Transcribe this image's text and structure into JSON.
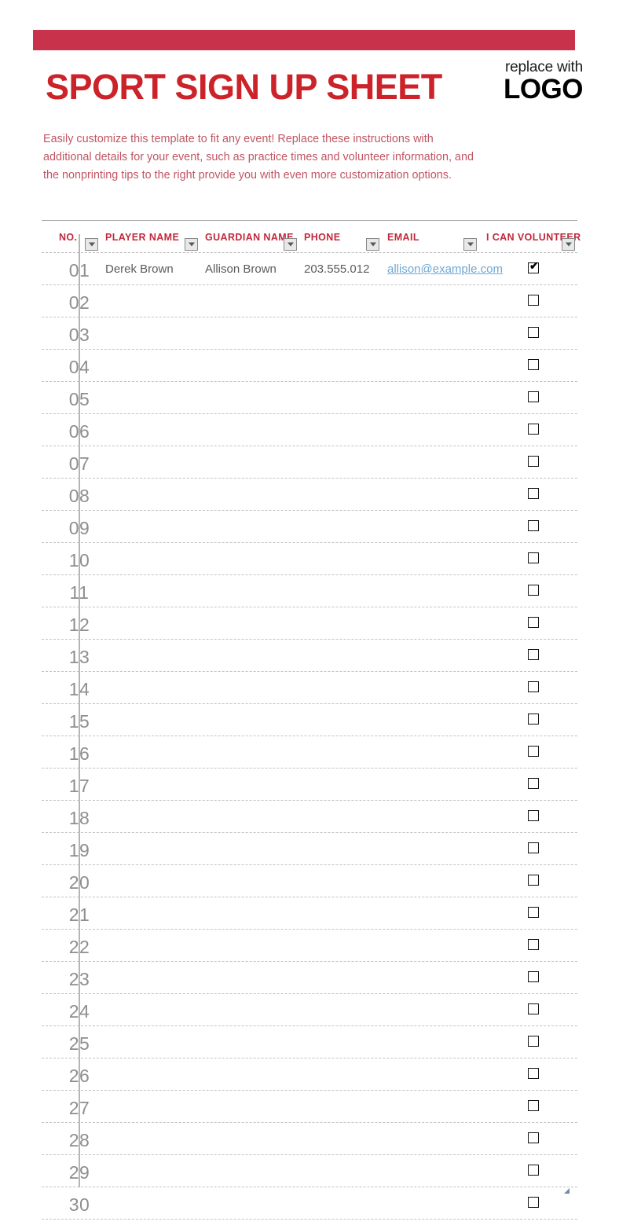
{
  "header": {
    "banner_color": "#c8324a",
    "title": "SPORT SIGN UP SHEET",
    "title_color": "#cc2229",
    "logo_sub": "replace with",
    "logo_main": "LOGO"
  },
  "instructions": {
    "text": "Easily customize this template to fit any event! Replace these instructions with additional details for your event, such as practice times and volunteer information, and the nonprinting tips to the right provide you with even more customization options.",
    "color": "#c05563"
  },
  "table": {
    "columns": [
      {
        "label": "NO.",
        "filter": true
      },
      {
        "label": "PLAYER NAME",
        "filter": true
      },
      {
        "label": "GUARDIAN NAME",
        "filter": true
      },
      {
        "label": "PHONE",
        "filter": true
      },
      {
        "label": "EMAIL",
        "filter": true
      },
      {
        "label": "I CAN VOLUNTEER",
        "filter": true
      }
    ],
    "filter_icon": "chevron-down-icon",
    "rows": [
      {
        "no": "01",
        "player": "Derek Brown",
        "guardian": "Allison Brown",
        "phone": "203.555.012",
        "email": "allison@example.com",
        "volunteer": true
      },
      {
        "no": "02",
        "player": "",
        "guardian": "",
        "phone": "",
        "email": "",
        "volunteer": false
      },
      {
        "no": "03",
        "player": "",
        "guardian": "",
        "phone": "",
        "email": "",
        "volunteer": false
      },
      {
        "no": "04",
        "player": "",
        "guardian": "",
        "phone": "",
        "email": "",
        "volunteer": false
      },
      {
        "no": "05",
        "player": "",
        "guardian": "",
        "phone": "",
        "email": "",
        "volunteer": false
      },
      {
        "no": "06",
        "player": "",
        "guardian": "",
        "phone": "",
        "email": "",
        "volunteer": false
      },
      {
        "no": "07",
        "player": "",
        "guardian": "",
        "phone": "",
        "email": "",
        "volunteer": false
      },
      {
        "no": "08",
        "player": "",
        "guardian": "",
        "phone": "",
        "email": "",
        "volunteer": false
      },
      {
        "no": "09",
        "player": "",
        "guardian": "",
        "phone": "",
        "email": "",
        "volunteer": false
      },
      {
        "no": "10",
        "player": "",
        "guardian": "",
        "phone": "",
        "email": "",
        "volunteer": false
      },
      {
        "no": "11",
        "player": "",
        "guardian": "",
        "phone": "",
        "email": "",
        "volunteer": false
      },
      {
        "no": "12",
        "player": "",
        "guardian": "",
        "phone": "",
        "email": "",
        "volunteer": false
      },
      {
        "no": "13",
        "player": "",
        "guardian": "",
        "phone": "",
        "email": "",
        "volunteer": false
      },
      {
        "no": "14",
        "player": "",
        "guardian": "",
        "phone": "",
        "email": "",
        "volunteer": false
      },
      {
        "no": "15",
        "player": "",
        "guardian": "",
        "phone": "",
        "email": "",
        "volunteer": false
      },
      {
        "no": "16",
        "player": "",
        "guardian": "",
        "phone": "",
        "email": "",
        "volunteer": false
      },
      {
        "no": "17",
        "player": "",
        "guardian": "",
        "phone": "",
        "email": "",
        "volunteer": false
      },
      {
        "no": "18",
        "player": "",
        "guardian": "",
        "phone": "",
        "email": "",
        "volunteer": false
      },
      {
        "no": "19",
        "player": "",
        "guardian": "",
        "phone": "",
        "email": "",
        "volunteer": false
      },
      {
        "no": "20",
        "player": "",
        "guardian": "",
        "phone": "",
        "email": "",
        "volunteer": false
      },
      {
        "no": "21",
        "player": "",
        "guardian": "",
        "phone": "",
        "email": "",
        "volunteer": false
      },
      {
        "no": "22",
        "player": "",
        "guardian": "",
        "phone": "",
        "email": "",
        "volunteer": false
      },
      {
        "no": "23",
        "player": "",
        "guardian": "",
        "phone": "",
        "email": "",
        "volunteer": false
      },
      {
        "no": "24",
        "player": "",
        "guardian": "",
        "phone": "",
        "email": "",
        "volunteer": false
      },
      {
        "no": "25",
        "player": "",
        "guardian": "",
        "phone": "",
        "email": "",
        "volunteer": false
      },
      {
        "no": "26",
        "player": "",
        "guardian": "",
        "phone": "",
        "email": "",
        "volunteer": false
      },
      {
        "no": "27",
        "player": "",
        "guardian": "",
        "phone": "",
        "email": "",
        "volunteer": false
      },
      {
        "no": "28",
        "player": "",
        "guardian": "",
        "phone": "",
        "email": "",
        "volunteer": false
      },
      {
        "no": "29",
        "player": "",
        "guardian": "",
        "phone": "",
        "email": "",
        "volunteer": false
      },
      {
        "no": "30",
        "player": "",
        "guardian": "",
        "phone": "",
        "email": "",
        "volunteer": false
      }
    ]
  }
}
